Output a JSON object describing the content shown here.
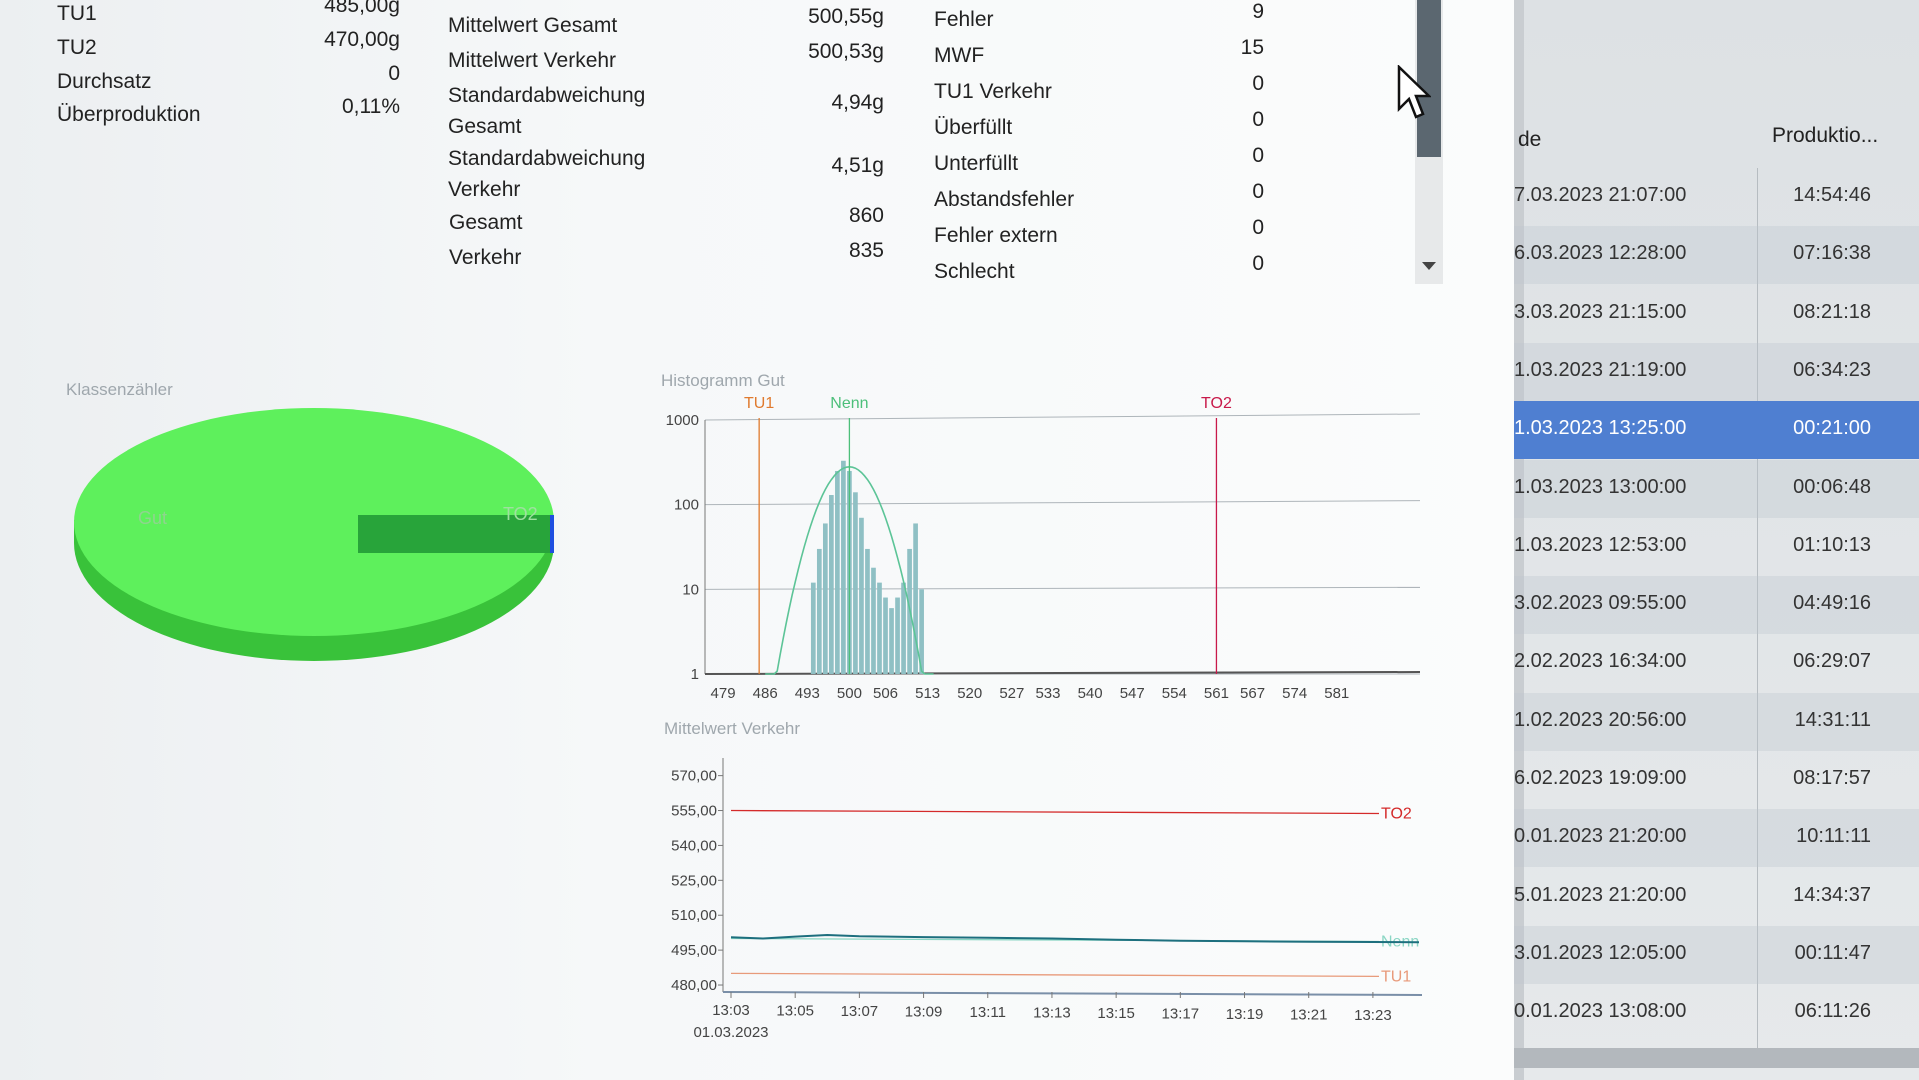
{
  "stats_left": [
    {
      "label": "TU1",
      "value": "485,00g"
    },
    {
      "label": "TU2",
      "value": "470,00g"
    },
    {
      "label": "Durchsatz",
      "value": "0"
    },
    {
      "label": "Überproduktion",
      "value": "0,11%"
    }
  ],
  "stats_mid": [
    {
      "label": "Mittelwert Gesamt",
      "value": "500,55g"
    },
    {
      "label": "Mittelwert Verkehr",
      "value": "500,53g"
    },
    {
      "label": "Standardabweichung Gesamt",
      "value": "4,94g"
    },
    {
      "label": "Standardabweichung Verkehr",
      "value": "4,51g"
    },
    {
      "label": "Gesamt",
      "value": "860"
    },
    {
      "label": "Verkehr",
      "value": "835"
    }
  ],
  "stats_right": [
    {
      "label": "Fehler",
      "value": "9"
    },
    {
      "label": "MWF",
      "value": "15"
    },
    {
      "label": "TU1 Verkehr",
      "value": "0"
    },
    {
      "label": "Überfüllt",
      "value": "0"
    },
    {
      "label": "Unterfüllt",
      "value": "0"
    },
    {
      "label": "Abstandsfehler",
      "value": "0"
    },
    {
      "label": "Fehler extern",
      "value": "0"
    },
    {
      "label": "Schlecht",
      "value": "0"
    }
  ],
  "pie": {
    "title": "Klassenzähler",
    "slices": [
      {
        "label": "Gut",
        "color": "#4de84d"
      },
      {
        "label": "TO2",
        "color": "#1f4fe0"
      }
    ]
  },
  "chart_data": [
    {
      "type": "bar",
      "title": "Histogramm Gut",
      "y_scale": "log",
      "ylim": [
        1,
        1000
      ],
      "yticks": [
        "1000",
        "100",
        "10",
        "1"
      ],
      "xticks": [
        "479",
        "486",
        "493",
        "500",
        "506",
        "513",
        "520",
        "527",
        "533",
        "540",
        "547",
        "554",
        "561",
        "567",
        "574",
        "581"
      ],
      "xlim": [
        476,
        594
      ],
      "markers": [
        {
          "label": "TU1",
          "x": 485,
          "color": "#e07a2e"
        },
        {
          "label": "Nenn",
          "x": 500,
          "color": "#4cbf7a"
        },
        {
          "label": "TO2",
          "x": 561,
          "color": "#c8194a"
        }
      ],
      "bins": [
        494,
        495,
        496,
        497,
        498,
        499,
        500,
        501,
        502,
        503,
        504,
        505,
        506,
        507,
        508,
        509,
        510,
        511,
        512
      ],
      "values": [
        12,
        30,
        60,
        130,
        250,
        330,
        250,
        140,
        70,
        30,
        18,
        12,
        8,
        6,
        8,
        12,
        30,
        60,
        10
      ]
    },
    {
      "type": "line",
      "title": "Mittelwert Verkehr",
      "ylim": [
        477,
        575
      ],
      "yticks": [
        "570,00",
        "555,00",
        "540,00",
        "525,00",
        "510,00",
        "495,00",
        "480,00"
      ],
      "xticks": [
        "13:03",
        "13:05",
        "13:07",
        "13:09",
        "13:11",
        "13:13",
        "13:15",
        "13:17",
        "13:19",
        "13:21",
        "13:23"
      ],
      "x_sublabel": "01.03.2023",
      "reference_lines": [
        {
          "label": "TO2",
          "y": 555,
          "color": "#d42a2a"
        },
        {
          "label": "Nenn",
          "y": 500,
          "color": "#8ad6c4"
        },
        {
          "label": "TU1",
          "y": 485,
          "color": "#e89a7a"
        }
      ],
      "series": [
        {
          "x": [
            "13:03",
            "13:04",
            "13:05",
            "13:06",
            "13:07",
            "13:09",
            "13:11",
            "13:13",
            "13:15",
            "13:17",
            "13:19",
            "13:21",
            "13:23"
          ],
          "values": [
            500.5,
            500,
            500.8,
            501.5,
            501,
            500.6,
            500.3,
            500,
            499.5,
            499,
            498.8,
            498.6,
            498.5
          ]
        }
      ]
    }
  ],
  "table": {
    "headers": {
      "end": "de",
      "prod": "Produktio..."
    },
    "rows": [
      {
        "end": "7.03.2023 21:07:00",
        "prod": "14:54:46"
      },
      {
        "end": "6.03.2023 12:28:00",
        "prod": "07:16:38"
      },
      {
        "end": "3.03.2023 21:15:00",
        "prod": "08:21:18"
      },
      {
        "end": "1.03.2023 21:19:00",
        "prod": "06:34:23"
      },
      {
        "end": "1.03.2023 13:25:00",
        "prod": "00:21:00",
        "selected": true
      },
      {
        "end": "1.03.2023 13:00:00",
        "prod": "00:06:48"
      },
      {
        "end": "1.03.2023 12:53:00",
        "prod": "01:10:13"
      },
      {
        "end": "3.02.2023 09:55:00",
        "prod": "04:49:16"
      },
      {
        "end": "2.02.2023 16:34:00",
        "prod": "06:29:07"
      },
      {
        "end": "1.02.2023 20:56:00",
        "prod": "14:31:11"
      },
      {
        "end": "6.02.2023 19:09:00",
        "prod": "08:17:57"
      },
      {
        "end": "0.01.2023 21:20:00",
        "prod": "10:11:11"
      },
      {
        "end": "5.01.2023 21:20:00",
        "prod": "14:34:37"
      },
      {
        "end": "3.01.2023 12:05:00",
        "prod": "00:11:47"
      },
      {
        "end": "0.01.2023 13:08:00",
        "prod": "06:11:26"
      }
    ]
  }
}
